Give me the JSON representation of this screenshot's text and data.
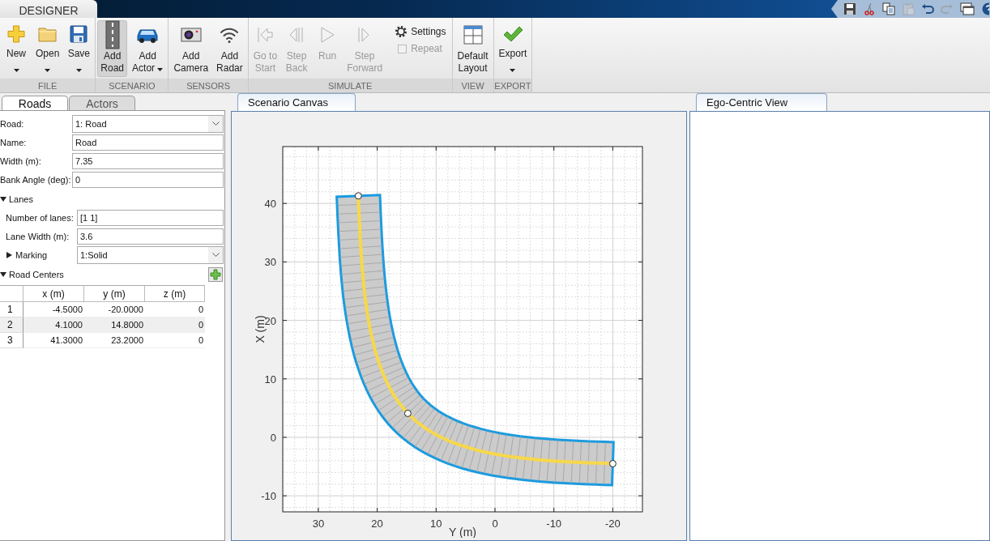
{
  "title_bar": {
    "tab": "DESIGNER"
  },
  "quick_access": [
    {
      "kind": "save",
      "disabled": false
    },
    {
      "kind": "cut",
      "disabled": false
    },
    {
      "kind": "copy",
      "disabled": false
    },
    {
      "kind": "paste",
      "disabled": true
    },
    {
      "kind": "undo",
      "disabled": false
    },
    {
      "kind": "redo",
      "disabled": true
    },
    {
      "kind": "windows",
      "disabled": false
    },
    {
      "kind": "help",
      "disabled": false
    }
  ],
  "ribbon": [
    {
      "label": "FILE",
      "items": [
        {
          "kind": "large",
          "label": "New",
          "dropdown": true,
          "disabled": false,
          "selected": false
        },
        {
          "kind": "large",
          "label": "Open",
          "dropdown": true,
          "disabled": false,
          "selected": false
        },
        {
          "kind": "large",
          "label": "Save",
          "dropdown": true,
          "disabled": false,
          "selected": false
        }
      ]
    },
    {
      "label": "SCENARIO",
      "items": [
        {
          "kind": "large",
          "label": "Add\nRoad",
          "dropdown": false,
          "disabled": false,
          "selected": true
        },
        {
          "kind": "large",
          "label": "Add\nActor",
          "dropdown": true,
          "disabled": false,
          "selected": false
        }
      ]
    },
    {
      "label": "SENSORS",
      "items": [
        {
          "kind": "large",
          "label": "Add\nCamera",
          "dropdown": false,
          "disabled": false,
          "selected": false
        },
        {
          "kind": "large",
          "label": "Add\nRadar",
          "dropdown": false,
          "disabled": false,
          "selected": false
        }
      ]
    },
    {
      "label": "SIMULATE",
      "items": [
        {
          "kind": "large",
          "label": "Go to\nStart",
          "dropdown": false,
          "disabled": true,
          "selected": false
        },
        {
          "kind": "large",
          "label": "Step\nBack",
          "dropdown": false,
          "disabled": true,
          "selected": false
        },
        {
          "kind": "large",
          "label": "Run",
          "dropdown": false,
          "disabled": true,
          "selected": false
        },
        {
          "kind": "large",
          "label": "Step\nForward",
          "dropdown": false,
          "disabled": true,
          "selected": false
        },
        {
          "kind": "small",
          "label": "Settings",
          "disabled": false
        },
        {
          "kind": "checkbox",
          "label": "Repeat",
          "checked": false,
          "disabled": true
        }
      ]
    },
    {
      "label": "VIEW",
      "items": [
        {
          "kind": "large",
          "label": "Default\nLayout",
          "dropdown": false,
          "disabled": false,
          "selected": false
        }
      ]
    },
    {
      "label": "EXPORT",
      "items": [
        {
          "kind": "large",
          "label": "Export",
          "dropdown": true,
          "disabled": false,
          "selected": false
        }
      ]
    }
  ],
  "left_panel": {
    "tabs": [
      {
        "label": "Roads",
        "selected": true
      },
      {
        "label": "Actors",
        "selected": false
      }
    ],
    "fields": [
      {
        "label": "Road:",
        "kind": "dropdown",
        "value": "1: Road"
      },
      {
        "label": "Name:",
        "kind": "text",
        "value": "Road"
      },
      {
        "label": "Width (m):",
        "kind": "text",
        "value": "7.35"
      },
      {
        "label": "Bank Angle (deg):",
        "kind": "text",
        "value": "0"
      }
    ],
    "lanes": {
      "title": "Lanes",
      "expanded": true,
      "fields": [
        {
          "label": "Number of lanes:",
          "kind": "text",
          "value": "[1 1]"
        },
        {
          "label": "Lane Width (m):",
          "kind": "text",
          "value": "3.6"
        }
      ],
      "marking": {
        "title": "Marking",
        "expanded": false,
        "value": "1:Solid"
      }
    },
    "road_centers": {
      "title": "Road Centers",
      "expanded": true,
      "columns": [
        "x (m)",
        "y (m)",
        "z (m)"
      ],
      "rows": [
        {
          "number": "1",
          "cells": [
            "-4.5000",
            "-20.0000",
            "0"
          ]
        },
        {
          "number": "2",
          "cells": [
            "4.1000",
            "14.8000",
            "0"
          ]
        },
        {
          "number": "3",
          "cells": [
            "41.3000",
            "23.2000",
            "0"
          ]
        }
      ]
    }
  },
  "canvas_panel": {
    "tab": {
      "label": "Scenario Canvas",
      "selected": true
    },
    "plot": {
      "xlabel": "Y (m)",
      "ylabel": "X (m)",
      "xticks": [
        "30",
        "20",
        "10",
        "0",
        "-10",
        "-20"
      ],
      "yticks": [
        "40",
        "30",
        "20",
        "10",
        "0",
        "-10"
      ]
    }
  },
  "ego_panel": {
    "tab": {
      "label": "Ego-Centric View",
      "selected": true
    }
  }
}
